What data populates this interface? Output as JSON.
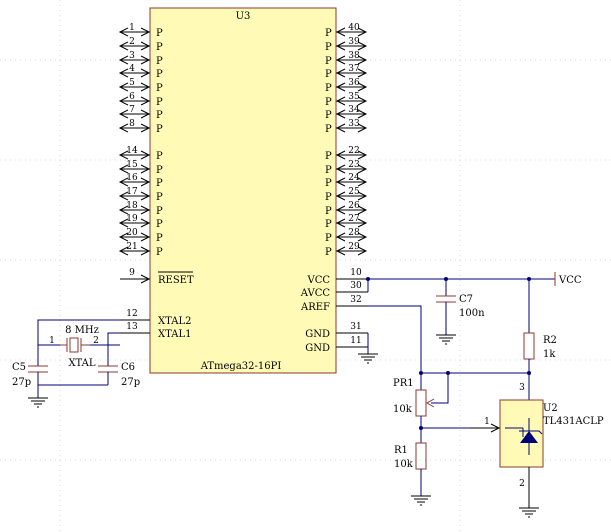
{
  "ic_u3": {
    "designator": "U3",
    "part": "ATmega32-16PI",
    "left_pins": [
      "1",
      "2",
      "3",
      "4",
      "5",
      "6",
      "7",
      "8",
      "14",
      "15",
      "16",
      "17",
      "18",
      "19",
      "20",
      "21"
    ],
    "right_pins": [
      "40",
      "39",
      "38",
      "37",
      "36",
      "35",
      "34",
      "33",
      "22",
      "23",
      "24",
      "25",
      "26",
      "27",
      "28",
      "29"
    ],
    "port_label": "P",
    "reset_pin": "9",
    "reset_label": "RESET",
    "xtal2_pin": "12",
    "xtal2_label": "XTAL2",
    "xtal1_pin": "13",
    "xtal1_label": "XTAL1",
    "vcc_pin": "10",
    "vcc_label": "VCC",
    "avcc_pin": "30",
    "avcc_label": "AVCC",
    "aref_pin": "32",
    "aref_label": "AREF",
    "gnd1_pin": "31",
    "gnd1_label": "GND",
    "gnd2_pin": "11",
    "gnd2_label": "GND"
  },
  "crystal": {
    "freq": "8 MHz",
    "pin1": "1",
    "pin2": "2",
    "name": "XTAL"
  },
  "c5": {
    "designator": "C5",
    "value": "27p"
  },
  "c6": {
    "designator": "C6",
    "value": "27p"
  },
  "c7": {
    "designator": "C7",
    "value": "100n"
  },
  "r2": {
    "designator": "R2",
    "value": "1k"
  },
  "pr1": {
    "designator": "PR1",
    "value": "10k"
  },
  "r1": {
    "designator": "R1",
    "value": "10k"
  },
  "u2": {
    "designator": "U2",
    "part": "TL431ACLP",
    "pin1": "1",
    "pin2": "2",
    "pin3": "3"
  },
  "power": {
    "vcc_label": "VCC"
  },
  "colors": {
    "part_fill": "#fffbb6",
    "part_stroke": "#8b3a2f",
    "wire": "#00007a"
  }
}
